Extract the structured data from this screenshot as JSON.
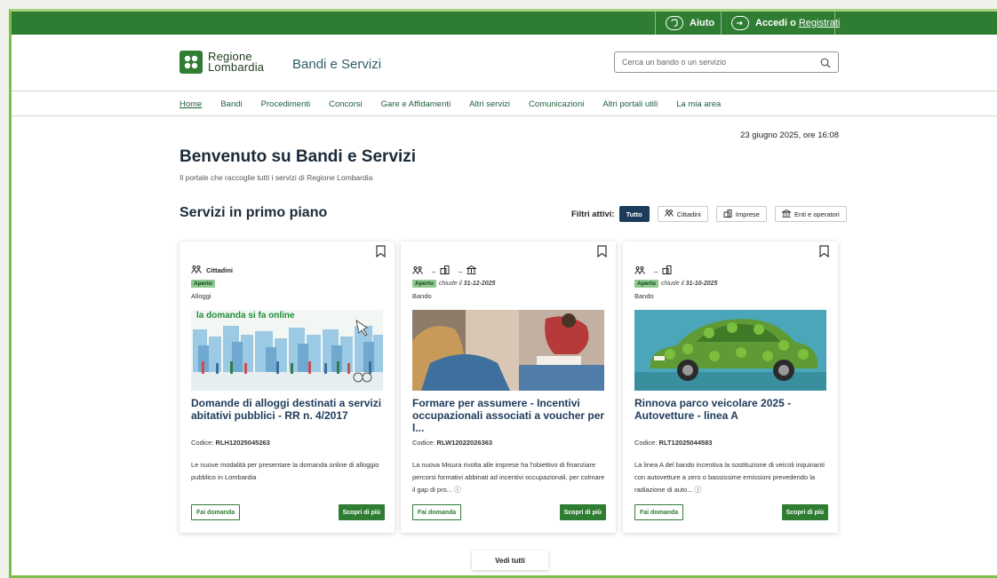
{
  "topbar": {
    "help_label": "Aiuto",
    "login_label": "Accedi o",
    "register_label": "Registrati"
  },
  "header": {
    "logo_line1": "Regione",
    "logo_line2": "Lombardia",
    "site_title": "Bandi e Servizi",
    "search_placeholder": "Cerca un bando o un servizio"
  },
  "nav": {
    "items": [
      {
        "label": "Home"
      },
      {
        "label": "Bandi"
      },
      {
        "label": "Procedimenti"
      },
      {
        "label": "Concorsi"
      },
      {
        "label": "Gare e Affidamenti"
      },
      {
        "label": "Altri servizi"
      },
      {
        "label": "Comunicazioni"
      },
      {
        "label": "Altri portali utili"
      },
      {
        "label": "La mia area"
      }
    ]
  },
  "page": {
    "date": "23 giugno 2025, ore 16:08",
    "welcome": "Benvenuto su Bandi e Servizi",
    "subtitle": "Il portale che raccoglie tutti i servizi di Regione Lombardia",
    "section_title": "Servizi in primo piano"
  },
  "filters": {
    "label": "Filtri attivi:",
    "options": [
      {
        "label": "Tutto",
        "icon": ""
      },
      {
        "label": "Cittadini",
        "icon": "people-icon"
      },
      {
        "label": "Imprese",
        "icon": "building-icon"
      },
      {
        "label": "Enti e operatori",
        "icon": "institution-icon"
      }
    ]
  },
  "cards": [
    {
      "category": "Cittadini",
      "status": "Aperto",
      "closes_prefix": "",
      "closes_date": "",
      "type": "Alloggi",
      "image_caption": "la domanda si fa online",
      "title": "Domande di alloggi destinati a servizi abitativi pubblici - RR n. 4/2017",
      "code_label": "Codice:",
      "code": "RLH12025045263",
      "description": "Le nuove modalità per presentare la domanda online di alloggio pubblico in Lombardia",
      "apply_label": "Fai domanda",
      "more_label": "Scopri di più"
    },
    {
      "category": "",
      "status": "Aperto",
      "closes_prefix": "chiude il",
      "closes_date": "31-12-2025",
      "type": "Bando",
      "image_caption": "",
      "title": "Formare per assumere - Incentivi occupazionali associati a voucher per l...",
      "code_label": "Codice:",
      "code": "RLW12022026363",
      "description": "La nuova Misura rivolta alle imprese ha l'obiettivo di finanziare percorsi formativi abbinati ad incentivi occupazionali, per colmare il gap di pro... ⓘ",
      "apply_label": "Fai domanda",
      "more_label": "Scopri di più"
    },
    {
      "category": "",
      "status": "Aperto",
      "closes_prefix": "chiude il",
      "closes_date": "31-10-2025",
      "type": "Bando",
      "image_caption": "",
      "title": "Rinnova parco veicolare 2025 - Autovetture - linea A",
      "code_label": "Codice:",
      "code": "RLT12025044583",
      "description": "La linea A del bando incentiva la sostituzione di veicoli inquinanti con autovetture a zero o bassissime emissioni prevedendo la radiazione di auto... ⓘ",
      "apply_label": "Fai domanda",
      "more_label": "Scopri di più"
    }
  ],
  "see_all_label": "Vedi tutti",
  "colors": {
    "brand_green": "#2e7d32",
    "navy": "#1d3b5a",
    "badge_green": "#8fc98f"
  }
}
